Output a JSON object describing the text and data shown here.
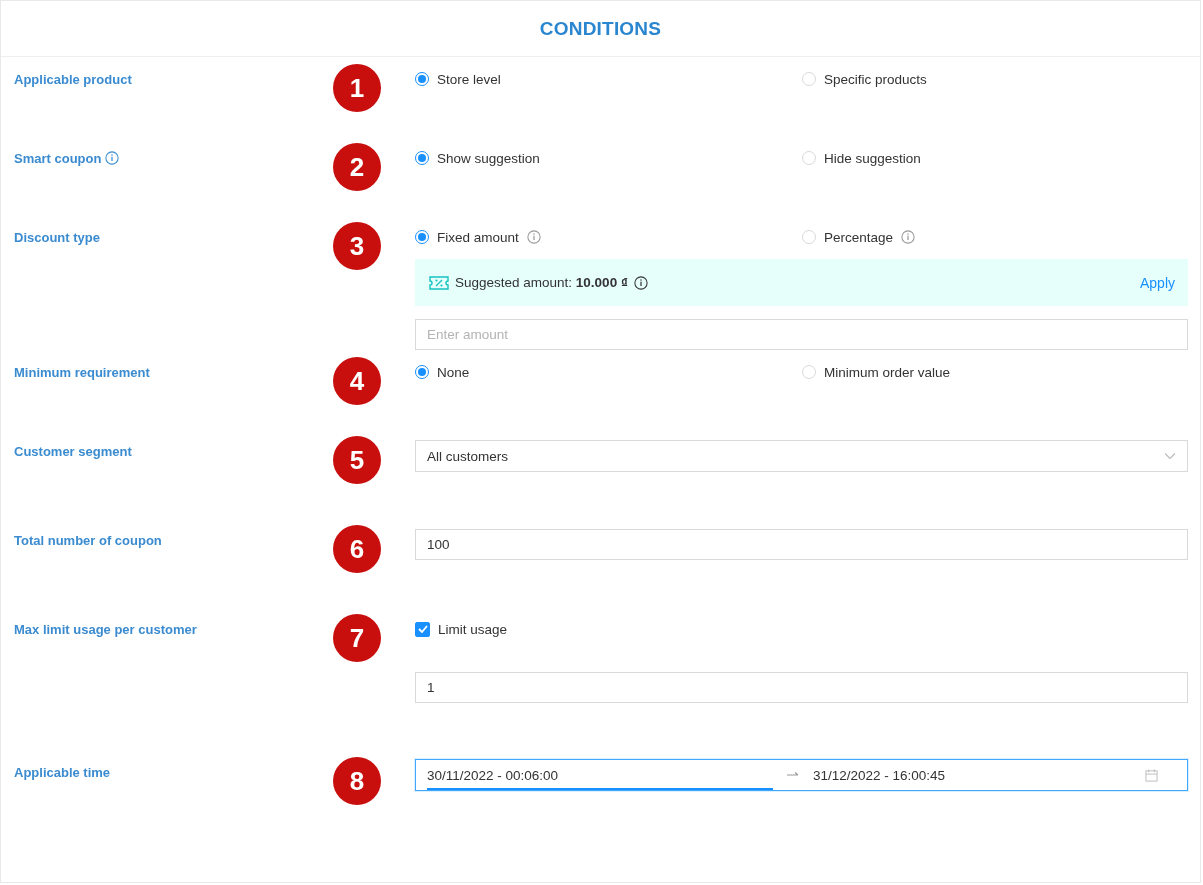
{
  "title": "CONDITIONS",
  "rows": [
    {
      "kind": "radio",
      "label": "Applicable product",
      "marker": "1",
      "options": [
        {
          "label": "Store level",
          "selected": true
        },
        {
          "label": "Specific products",
          "selected": false
        }
      ]
    },
    {
      "kind": "radio",
      "label": "Smart coupon",
      "label_info": true,
      "marker": "2",
      "options": [
        {
          "label": "Show suggestion",
          "selected": true
        },
        {
          "label": "Hide suggestion",
          "selected": false
        }
      ]
    },
    {
      "kind": "radio",
      "label": "Discount type",
      "marker": "3",
      "options": [
        {
          "label": "Fixed amount",
          "selected": true,
          "info": true
        },
        {
          "label": "Percentage",
          "selected": false,
          "info": true
        }
      ],
      "suggestion": {
        "text": "Suggested amount: **10.000 ₫**",
        "action": "Apply"
      },
      "field": {
        "placeholder": "Enter amount"
      }
    },
    {
      "kind": "radio",
      "label": "Minimum requirement",
      "marker": "4",
      "options": [
        {
          "label": "None",
          "selected": true
        },
        {
          "label": "Minimum order value",
          "selected": false
        }
      ]
    },
    {
      "kind": "select",
      "label": "Customer segment",
      "marker": "5",
      "value": "All customers"
    },
    {
      "kind": "input",
      "label": "Total number of coupon",
      "marker": "6",
      "value": "100"
    },
    {
      "kind": "checkbox",
      "label": "Max limit usage per customer",
      "marker": "7",
      "check": {
        "label": "Limit usage",
        "checked": true
      },
      "value": "1"
    },
    {
      "kind": "daterange",
      "label": "Applicable time",
      "marker": "8",
      "start": "30/11/2022 - 00:06:00",
      "end": "31/12/2022 - 16:00:45",
      "focused": true
    }
  ]
}
